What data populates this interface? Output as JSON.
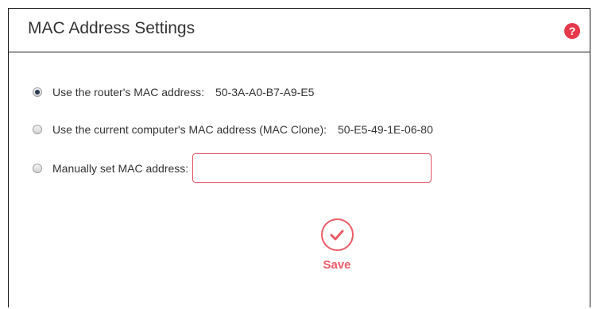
{
  "header": {
    "title": "MAC Address Settings",
    "help_icon": "?"
  },
  "options": [
    {
      "label": "Use the router's MAC address:",
      "value": "50-3A-A0-B7-A9-E5",
      "selected": true
    },
    {
      "label": "Use the current computer's MAC address (MAC Clone):",
      "value": "50-E5-49-1E-06-80",
      "selected": false
    },
    {
      "label": "Manually set MAC address:",
      "input_value": "",
      "selected": false
    }
  ],
  "save": {
    "label": "Save",
    "icon": "checkmark-icon"
  },
  "colors": {
    "accent": "#ec5b67",
    "help_icon_bg": "#e5384a",
    "text": "#333333"
  }
}
